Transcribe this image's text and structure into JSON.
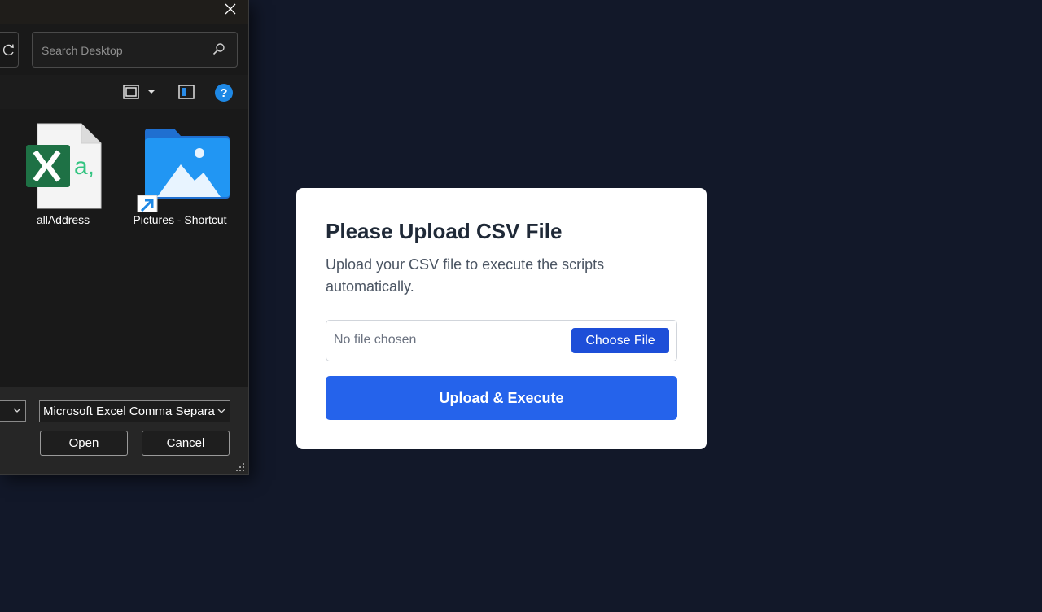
{
  "dialog": {
    "search": {
      "placeholder": "Search Desktop"
    },
    "files": [
      {
        "name": "allAddress",
        "icon": "excel-csv-file-icon"
      },
      {
        "name": "Pictures - Shortcut",
        "icon": "pictures-folder-shortcut-icon"
      }
    ],
    "toolbar": {
      "help_label": "?"
    },
    "file_type": "Microsoft Excel Comma Separa",
    "open_label": "Open",
    "cancel_label": "Cancel"
  },
  "card": {
    "title": "Please Upload CSV File",
    "description": "Upload your CSV file to execute the scripts automatically.",
    "file_status": "No file chosen",
    "choose_label": "Choose File",
    "submit_label": "Upload & Execute"
  },
  "colors": {
    "page_background": "#121829",
    "card_background": "#ffffff",
    "primary_button": "#2563eb",
    "choose_button": "#1d4ed8",
    "dialog_background": "#1c1c1c",
    "help_icon": "#1e88e5"
  }
}
